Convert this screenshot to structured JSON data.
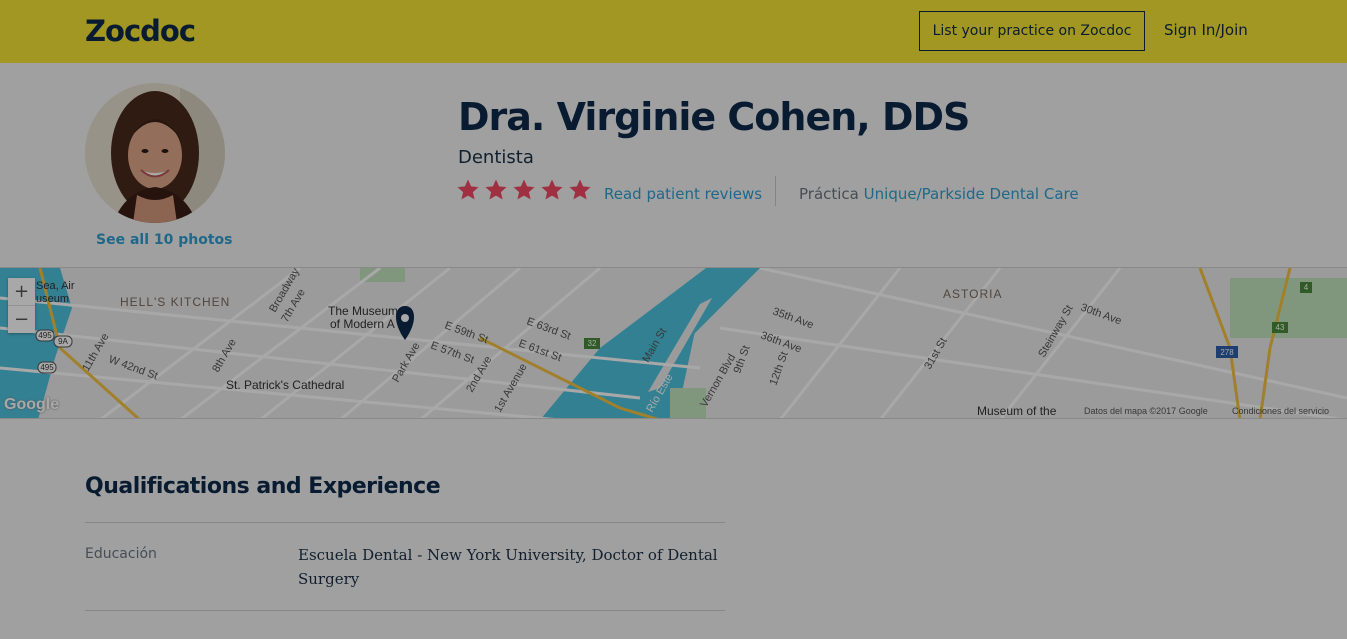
{
  "header": {
    "logo": "Zocdoc",
    "list_practice": "List your practice on Zocdoc",
    "sign_in": "Sign In/Join"
  },
  "profile": {
    "name": "Dra. Virginie Cohen, DDS",
    "specialty": "Dentista",
    "rating_stars": 5,
    "reviews_link": "Read patient reviews",
    "practice_label": "Práctica",
    "practice_name": "Unique/Parkside Dental Care",
    "photos_link": "See all 10 photos"
  },
  "map": {
    "zoom_in": "+",
    "zoom_out": "−",
    "google": "Google",
    "map_data": "Datos del mapa ©2017 Google",
    "terms": "Condiciones del servicio",
    "labels": {
      "hells_kitchen": "HELL'S KITCHEN",
      "astoria": "ASTORIA",
      "museum": "The Museum",
      "museum2": "of Modern A",
      "st_patricks": "St. Patrick's Cathedral",
      "museum_bottom": "Museum of the",
      "sea_air": "Sea, Air",
      "useum": "useum",
      "e59": "E 59th St",
      "e57": "E 57th St",
      "e63": "E 63rd St",
      "e61": "E 61st St",
      "w42": "W 42nd St",
      "ave11": "11th Ave",
      "ave8": "8th Ave",
      "ave7": "7th Ave",
      "broadway": "Broadway",
      "park": "Park Ave",
      "ave2": "2nd Ave",
      "ave1": "1st Avenue",
      "main": "Main St",
      "rio": "Río Este",
      "vernon": "Vernon Blvd",
      "st9": "9th St",
      "st12": "12th St",
      "ave35": "35th Ave",
      "ave36": "36th Ave",
      "st31": "31st St",
      "steinway": "Steinway St",
      "ave30": "30th Ave",
      "sh495a": "495",
      "sh495b": "495",
      "sh9a": "9A",
      "sh278": "278",
      "sh43": "43",
      "sh4": "4",
      "sh32": "32"
    }
  },
  "qualifications": {
    "title": "Qualifications and Experience",
    "education_label": "Educación",
    "education_value": "Escuela Dental - New York University, Doctor of Dental Surgery"
  },
  "colors": {
    "header_bg": "#f6e635",
    "navy": "#0d2a4a",
    "link": "#2f9fd0",
    "star": "#f24a65",
    "water": "#4fc3e0"
  }
}
